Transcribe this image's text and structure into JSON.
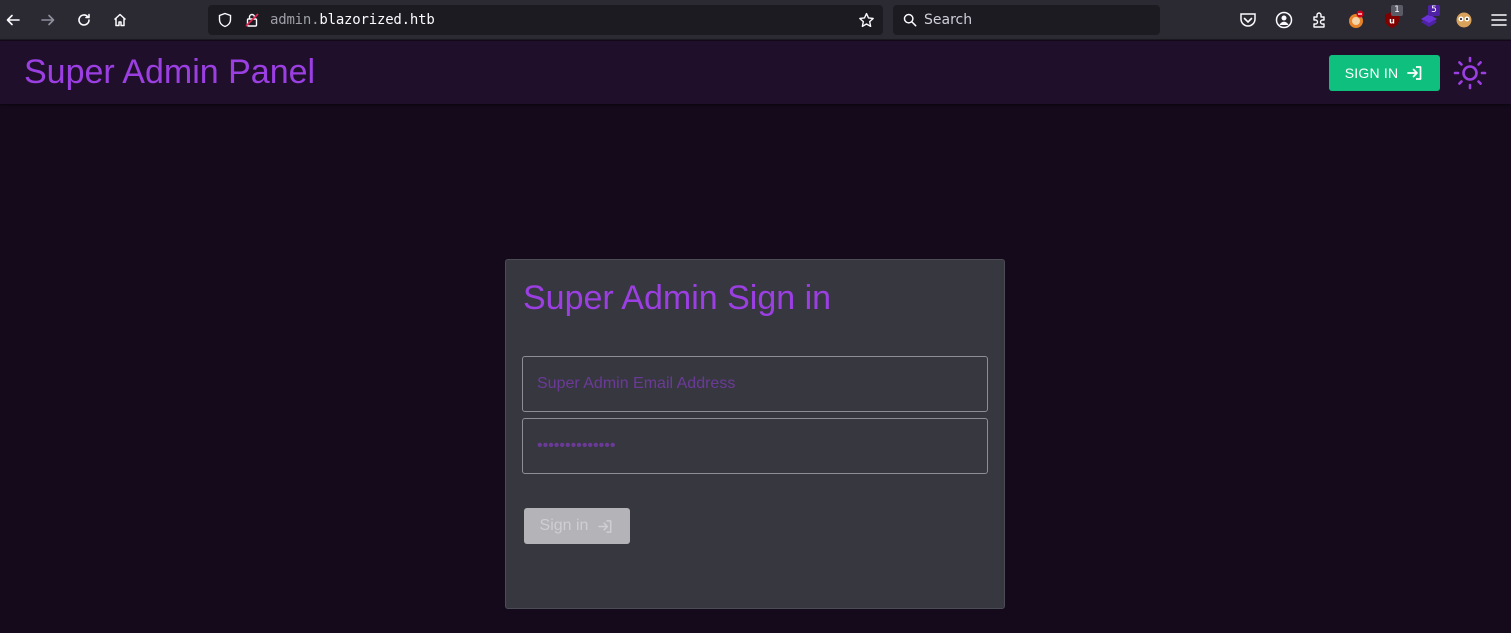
{
  "browser": {
    "url_prefix": "admin.",
    "url_domain": "blazorized.htb",
    "search_placeholder": "Search",
    "extensions": [
      {
        "icon": "ublock-icon",
        "badge": "1",
        "color": "#800000"
      },
      {
        "icon": "wappalyzer-icon",
        "badge": "5",
        "color": "#4f22a5"
      }
    ]
  },
  "header": {
    "title": "Super Admin Panel",
    "signin_label": "SIGN IN",
    "accent_color": "#9b3fe3",
    "button_color": "#0fbf7e"
  },
  "login": {
    "title": "Super Admin Sign in",
    "email_placeholder": "Super Admin Email Address",
    "password_placeholder": "••••••••••••••",
    "submit_label": "Sign in"
  }
}
